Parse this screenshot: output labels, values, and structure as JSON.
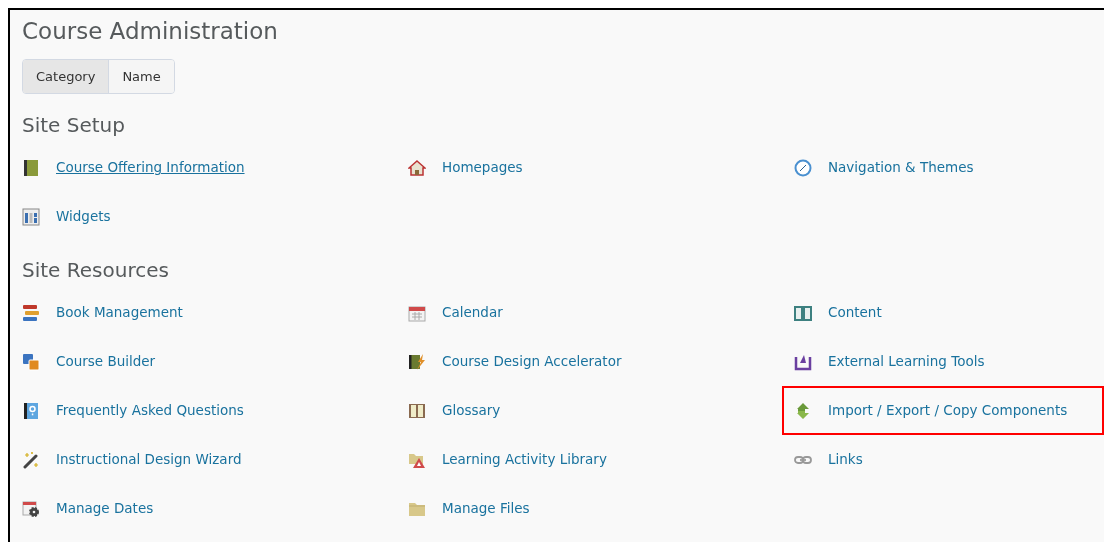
{
  "title": "Course Administration",
  "view_toggle": [
    {
      "label": "Category",
      "selected": true
    },
    {
      "label": "Name",
      "selected": false
    }
  ],
  "sections": [
    {
      "title": "Site Setup",
      "items": [
        {
          "label": "Course Offering Information",
          "kind": "green-book",
          "hovered": true,
          "highlighted": false
        },
        {
          "label": "Homepages",
          "kind": "house",
          "hovered": false,
          "highlighted": false
        },
        {
          "label": "Navigation & Themes",
          "kind": "compass",
          "hovered": false,
          "highlighted": false
        },
        {
          "label": "Widgets",
          "kind": "widgets",
          "hovered": false,
          "highlighted": false
        }
      ]
    },
    {
      "title": "Site Resources",
      "items": [
        {
          "label": "Book Management",
          "kind": "book-stack",
          "hovered": false,
          "highlighted": false
        },
        {
          "label": "Calendar",
          "kind": "calendar",
          "hovered": false,
          "highlighted": false
        },
        {
          "label": "Content",
          "kind": "open-book",
          "hovered": false,
          "highlighted": false
        },
        {
          "label": "Course Builder",
          "kind": "squares",
          "hovered": false,
          "highlighted": false
        },
        {
          "label": "Course Design Accelerator",
          "kind": "book-bolt",
          "hovered": false,
          "highlighted": false
        },
        {
          "label": "External Learning Tools",
          "kind": "tray",
          "hovered": false,
          "highlighted": false
        },
        {
          "label": "Frequently Asked Questions",
          "kind": "question-book",
          "hovered": false,
          "highlighted": false
        },
        {
          "label": "Glossary",
          "kind": "glossary",
          "hovered": false,
          "highlighted": false
        },
        {
          "label": "Import / Export / Copy Components",
          "kind": "arrows",
          "hovered": false,
          "highlighted": true
        },
        {
          "label": "Instructional Design Wizard",
          "kind": "wand",
          "hovered": false,
          "highlighted": false
        },
        {
          "label": "Learning Activity Library",
          "kind": "folder-warning",
          "hovered": false,
          "highlighted": false
        },
        {
          "label": "Links",
          "kind": "chain",
          "hovered": false,
          "highlighted": false
        },
        {
          "label": "Manage Dates",
          "kind": "calendar-gear",
          "hovered": false,
          "highlighted": false
        },
        {
          "label": "Manage Files",
          "kind": "folder",
          "hovered": false,
          "highlighted": false
        }
      ]
    }
  ]
}
